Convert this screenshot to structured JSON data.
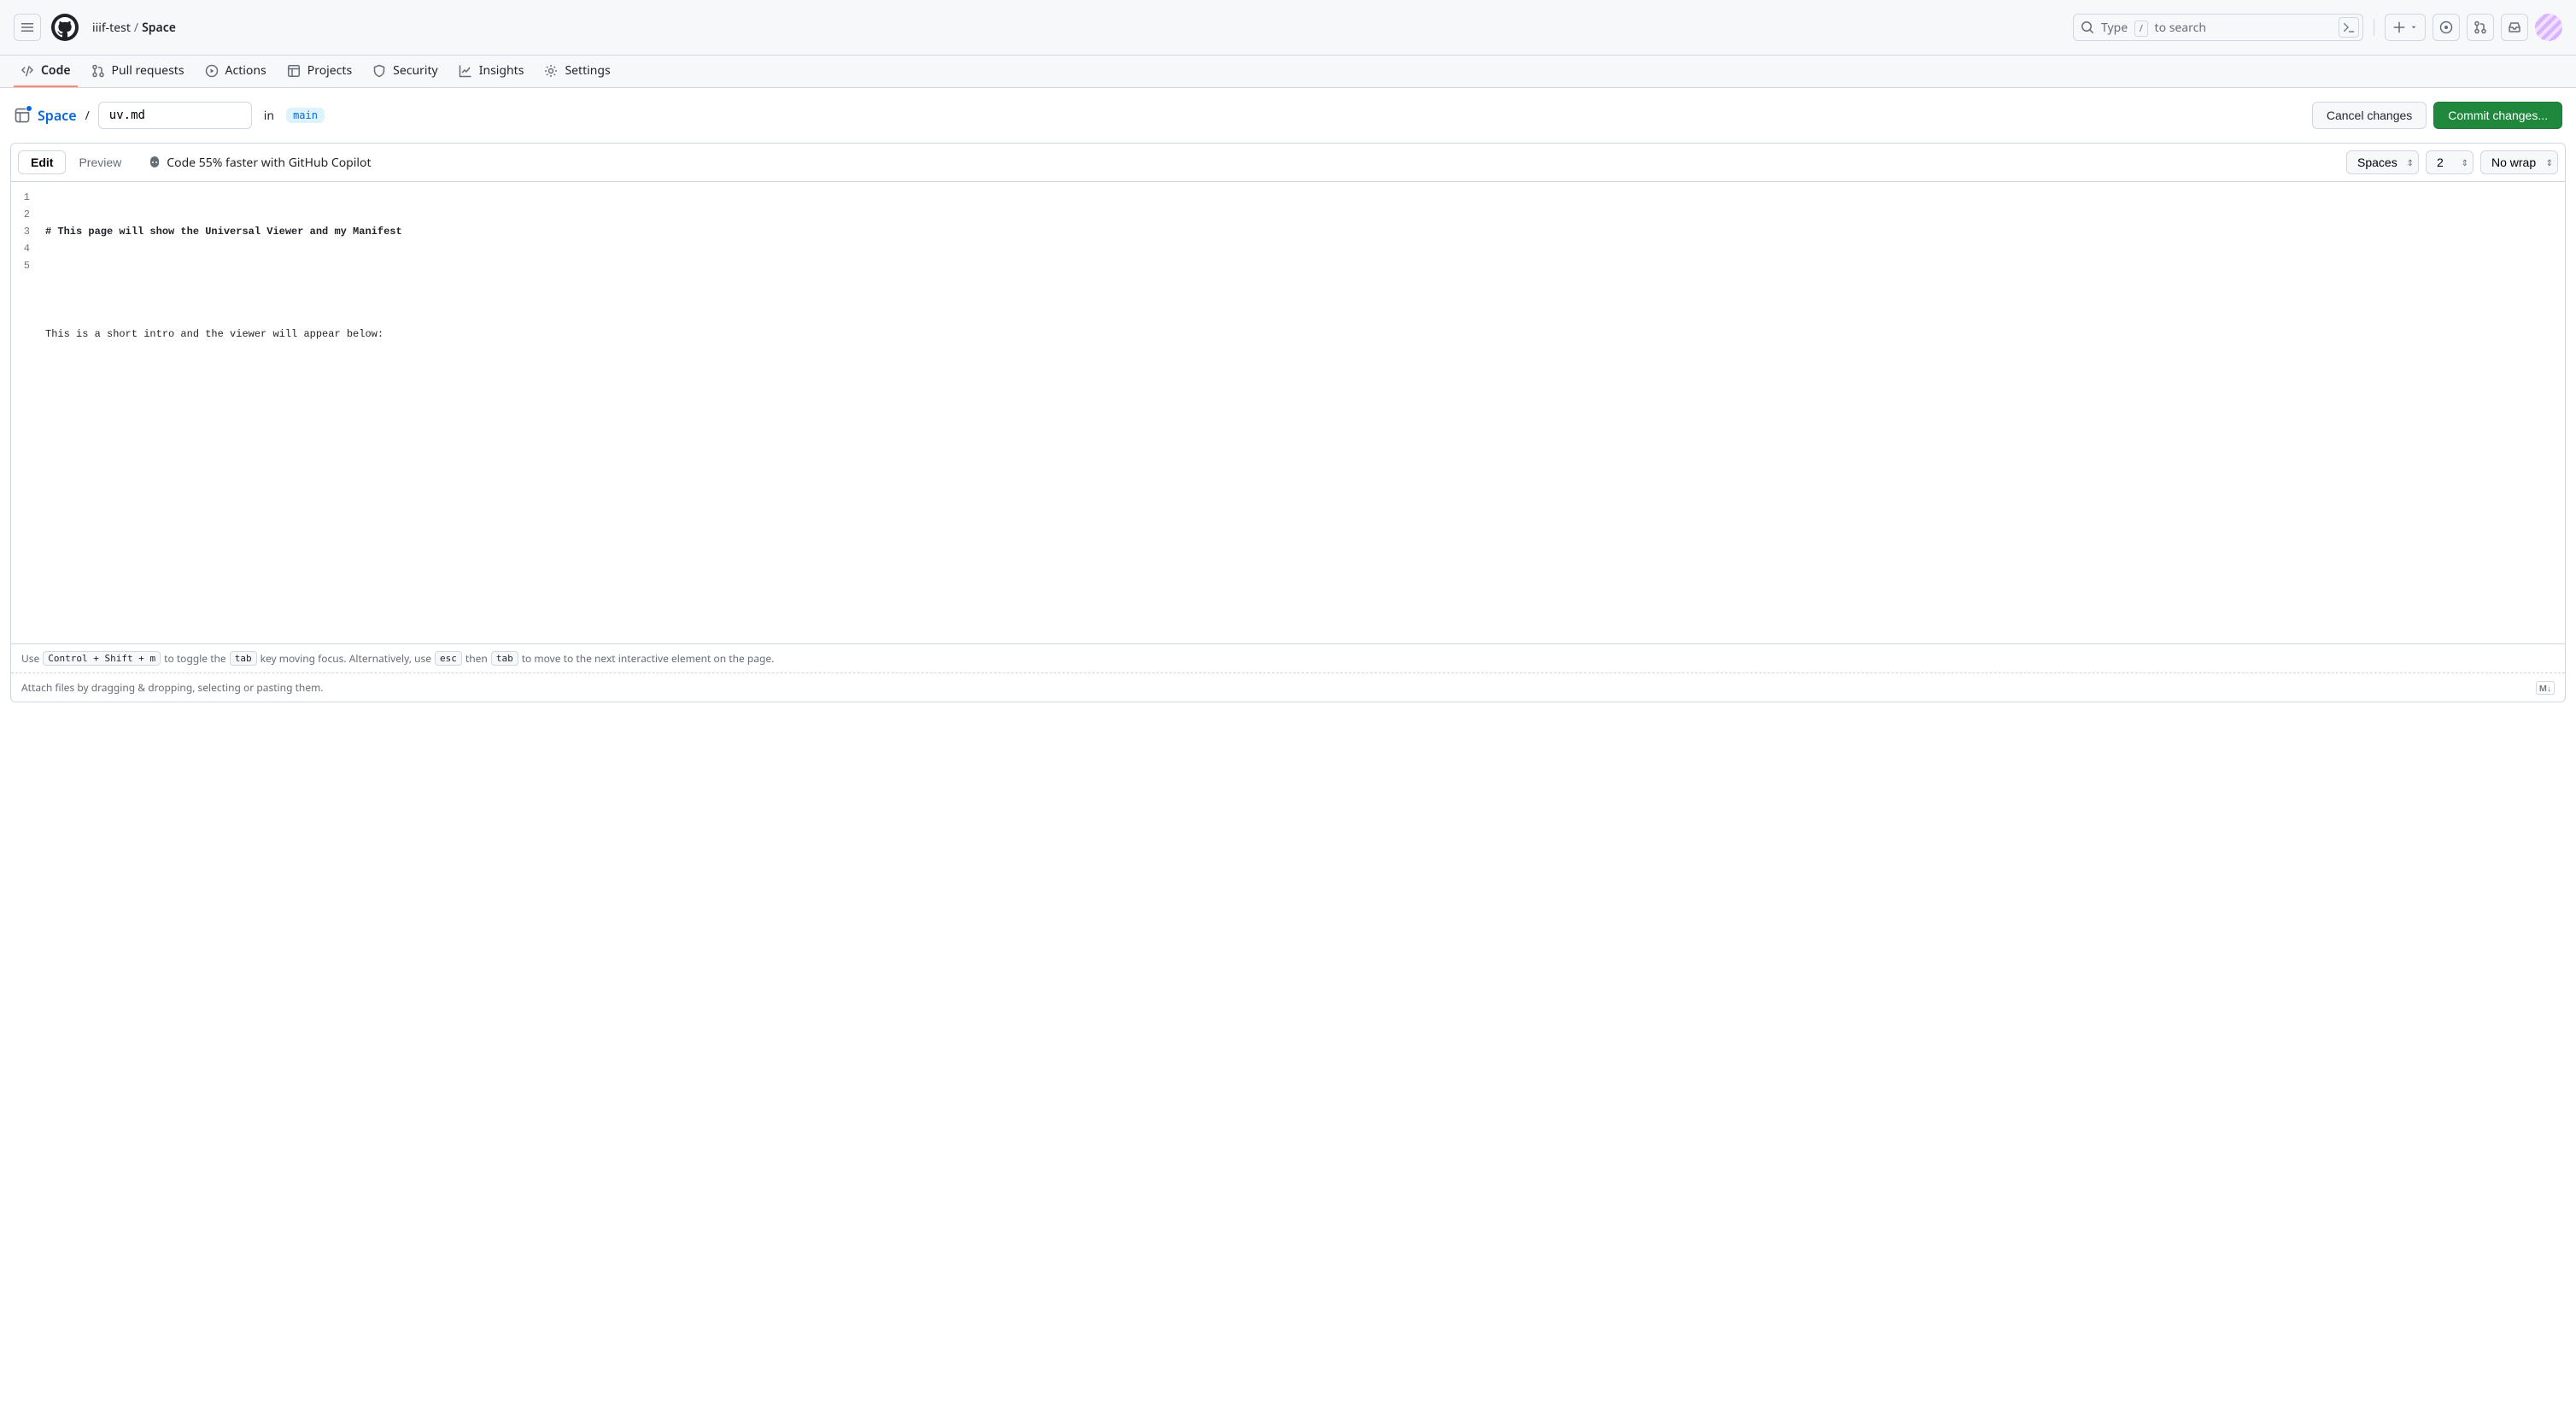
{
  "header": {
    "owner": "iiif-test",
    "repo": "Space",
    "search_prefix": "Type",
    "search_key": "/",
    "search_suffix": "to search"
  },
  "repo_nav": {
    "items": [
      {
        "label": "Code"
      },
      {
        "label": "Pull requests"
      },
      {
        "label": "Actions"
      },
      {
        "label": "Projects"
      },
      {
        "label": "Security"
      },
      {
        "label": "Insights"
      },
      {
        "label": "Settings"
      }
    ]
  },
  "file_header": {
    "repo": "Space",
    "filename": "uv.md",
    "in_label": "in",
    "branch": "main",
    "cancel_label": "Cancel changes",
    "commit_label": "Commit changes..."
  },
  "editor_toolbar": {
    "edit_tab": "Edit",
    "preview_tab": "Preview",
    "copilot_hint": "Code 55% faster with GitHub Copilot",
    "indent_mode": "Spaces",
    "indent_size": "2",
    "wrap_mode": "No wrap"
  },
  "code": {
    "lines": [
      "# This page will show the Universal Viewer and my Manifest",
      "",
      "This is a short intro and the viewer will appear below:",
      "",
      ""
    ]
  },
  "footer": {
    "hint_use": "Use",
    "kbd_toggle": "Control + Shift + m",
    "hint_toggle": " to toggle the ",
    "kbd_tab1": "tab",
    "hint_key_moving": " key moving focus. Alternatively, use ",
    "kbd_esc": "esc",
    "hint_then": " then ",
    "kbd_tab2": "tab",
    "hint_rest": " to move to the next interactive element on the page.",
    "attach_hint": "Attach files by dragging & dropping, selecting or pasting them.",
    "md_label": "M↓"
  }
}
